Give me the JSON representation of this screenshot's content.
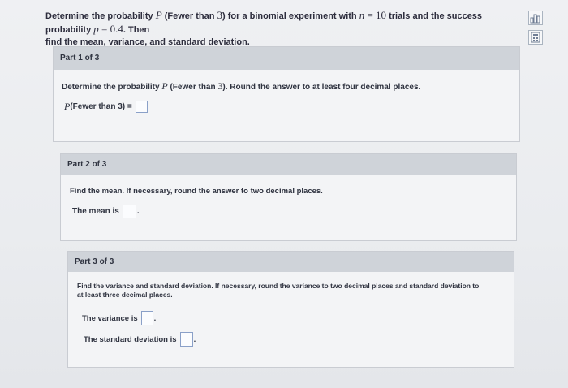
{
  "problem": {
    "l1_a": "Determine the probability ",
    "l1_P": "P",
    "l1_b": " (Fewer than ",
    "l1_3": "3",
    "l1_c": ") for a binomial experiment with ",
    "l1_n": "n",
    "l1_d": " = ",
    "l1_10": "10",
    "l1_e": " trials and the success probability ",
    "l1_p": "p",
    "l1_f": " = ",
    "l1_04": "0.4",
    "l1_g": ". Then",
    "l2": "find the mean, variance, and standard deviation."
  },
  "tools": {
    "icon1": "chart-icon",
    "icon2": "calculator-icon"
  },
  "part1": {
    "header": "Part 1 of 3",
    "q_a": "Determine the probability ",
    "q_P": "P",
    "q_b": " (Fewer than ",
    "q_3": "3",
    "q_c": "). Round the answer to at least four decimal places.",
    "ans_P": "P",
    "ans_label": " (Fewer than 3) =",
    "ans_value": ""
  },
  "part2": {
    "header": "Part 2 of 3",
    "question": "Find the mean. If necessary, round the answer to two decimal places.",
    "mean_label": "The mean is",
    "mean_value": "",
    "suffix": "."
  },
  "part3": {
    "header": "Part 3 of 3",
    "question_l1": "Find the variance and standard deviation. If necessary, round the variance to two decimal places and standard deviation to",
    "question_l2": "at least three decimal places.",
    "var_label": "The variance is",
    "var_value": "",
    "sd_label": "The standard deviation is",
    "sd_value": "",
    "suffix": "."
  }
}
